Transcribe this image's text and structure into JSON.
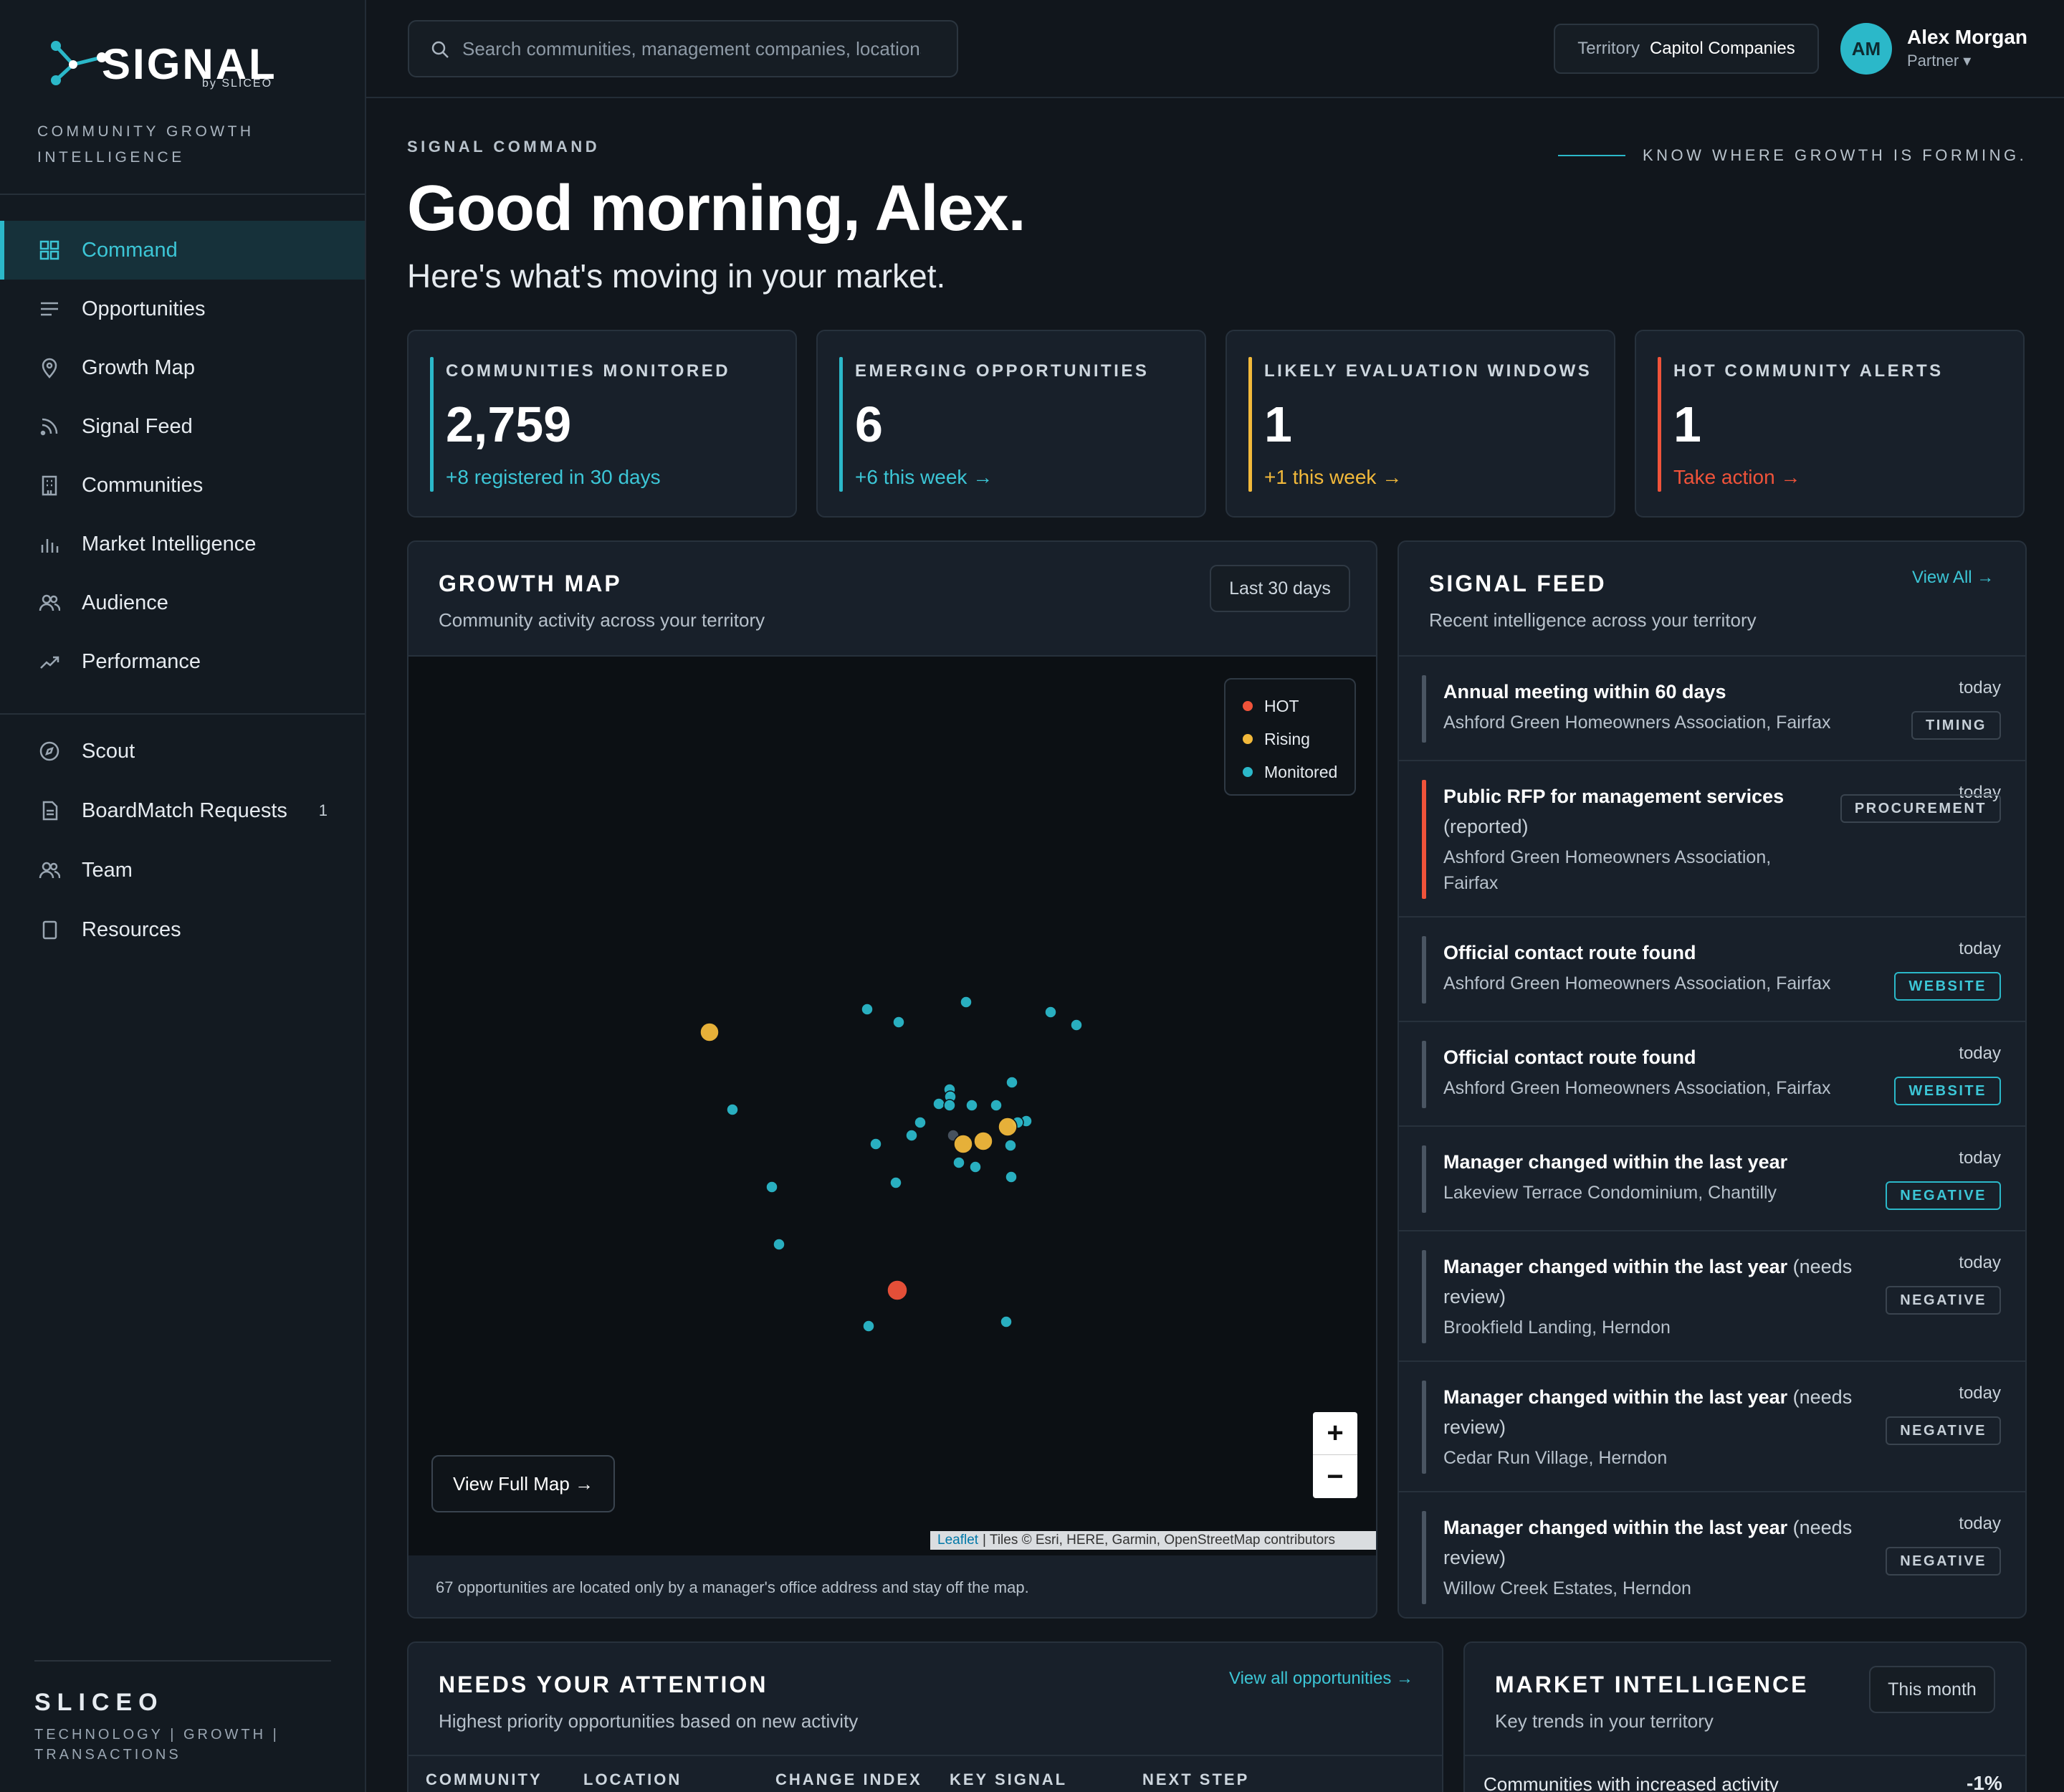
{
  "brand": {
    "word": "SIGNAL",
    "by": "by SLICEO",
    "tagline": "COMMUNITY GROWTH INTELLIGENCE",
    "footer_name": "SLICEO",
    "footer_sub": "TECHNOLOGY  |  GROWTH  |  TRANSACTIONS"
  },
  "nav": {
    "primary": [
      {
        "label": "Command",
        "icon": "grid-icon",
        "active": true
      },
      {
        "label": "Opportunities",
        "icon": "list-icon"
      },
      {
        "label": "Growth Map",
        "icon": "pin-icon"
      },
      {
        "label": "Signal Feed",
        "icon": "rss-icon"
      },
      {
        "label": "Communities",
        "icon": "building-icon"
      },
      {
        "label": "Market Intelligence",
        "icon": "bar-chart-icon"
      },
      {
        "label": "Audience",
        "icon": "users-icon"
      },
      {
        "label": "Performance",
        "icon": "trend-icon"
      }
    ],
    "secondary": [
      {
        "label": "Scout",
        "icon": "compass-icon"
      },
      {
        "label": "BoardMatch Requests",
        "icon": "doc-icon",
        "badge": "1"
      },
      {
        "label": "Team",
        "icon": "users-icon"
      },
      {
        "label": "Resources",
        "icon": "book-icon"
      }
    ]
  },
  "topbar": {
    "search_placeholder": "Search communities, management companies, locations...",
    "territory_label": "Territory",
    "territory_value": "Capitol Companies",
    "user_initials": "AM",
    "user_name": "Alex Morgan",
    "user_role": "Partner ▾"
  },
  "header": {
    "eyebrow": "SIGNAL COMMAND",
    "motto": "KNOW WHERE GROWTH IS FORMING.",
    "greeting": "Good morning, Alex.",
    "subtitle": "Here's what's moving in your market."
  },
  "kpis": [
    {
      "label": "COMMUNITIES MONITORED",
      "value": "2,759",
      "sub": "+8 registered in 30 days",
      "color": "#2bb8c9"
    },
    {
      "label": "EMERGING OPPORTUNITIES",
      "value": "6",
      "sub": "+6 this week →",
      "color": "#2bb8c9"
    },
    {
      "label": "LIKELY EVALUATION WINDOWS",
      "value": "1",
      "sub": "+1 this week →",
      "color": "#f2b93b"
    },
    {
      "label": "HOT COMMUNITY ALERTS",
      "value": "1",
      "sub": "Take action →",
      "color": "#f0533a"
    }
  ],
  "growth_map": {
    "title": "GROWTH MAP",
    "subtitle": "Community activity across your territory",
    "range": "Last 30 days",
    "legend": [
      {
        "label": "HOT",
        "color": "#f0533a"
      },
      {
        "label": "Rising",
        "color": "#f2b93b"
      },
      {
        "label": "Monitored",
        "color": "#2bb8c9"
      }
    ],
    "view_full": "View Full Map →",
    "zoom_in": "+",
    "zoom_out": "−",
    "attribution_leaflet": "Leaflet",
    "attribution_rest": "| Tiles © Esri, HERE, Garmin, OpenStreetMap contributors",
    "note": "67 opportunities are located only by a manager's office address and stay off the map."
  },
  "signal_feed": {
    "title": "SIGNAL FEED",
    "subtitle": "Recent intelligence across your territory",
    "view_all": "View All →",
    "items": [
      {
        "title": "Annual meeting within 60 days",
        "extra": "",
        "location": "Ashford Green Homeowners Association, Fairfax",
        "time": "today",
        "tag": "TIMING",
        "accent": "#4a5562"
      },
      {
        "title": "Public RFP for management services",
        "extra": "(reported)",
        "location": "Ashford Green Homeowners Association, Fairfax",
        "time": "today",
        "tag": "PROCUREMENT",
        "accent": "#f0533a"
      },
      {
        "title": "Official contact route found",
        "extra": "",
        "location": "Ashford Green Homeowners Association, Fairfax",
        "time": "today",
        "tag": "WEBSITE",
        "accent": "#4a5562"
      },
      {
        "title": "Official contact route found",
        "extra": "",
        "location": "Ashford Green Homeowners Association, Fairfax",
        "time": "today",
        "tag": "WEBSITE",
        "accent": "#4a5562"
      },
      {
        "title": "Manager changed within the last year",
        "extra": "",
        "location": "Lakeview Terrace Condominium, Chantilly",
        "time": "today",
        "tag": "NEGATIVE",
        "accent": "#4a5562"
      },
      {
        "title": "Manager changed within the last year",
        "extra": "(needs review)",
        "location": "Brookfield Landing, Herndon",
        "time": "today",
        "tag": "NEGATIVE",
        "accent": "#4a5562"
      },
      {
        "title": "Manager changed within the last year",
        "extra": "(needs review)",
        "location": "Cedar Run Village, Herndon",
        "time": "today",
        "tag": "NEGATIVE",
        "accent": "#4a5562"
      },
      {
        "title": "Manager changed within the last year",
        "extra": "(needs review)",
        "location": "Willow Creek Estates, Herndon",
        "time": "today",
        "tag": "NEGATIVE",
        "accent": "#4a5562"
      }
    ]
  },
  "attention": {
    "title": "NEEDS YOUR ATTENTION",
    "subtitle": "Highest priority opportunities based on new activity",
    "link": "View all opportunities →",
    "columns": [
      "COMMUNITY",
      "LOCATION",
      "CHANGE INDEX",
      "KEY SIGNAL",
      "NEXT STEP"
    ]
  },
  "market": {
    "title": "MARKET INTELLIGENCE",
    "subtitle": "Key trends in your territory",
    "range": "This month",
    "row_label": "Communities with increased activity",
    "row_value": "-1%"
  }
}
